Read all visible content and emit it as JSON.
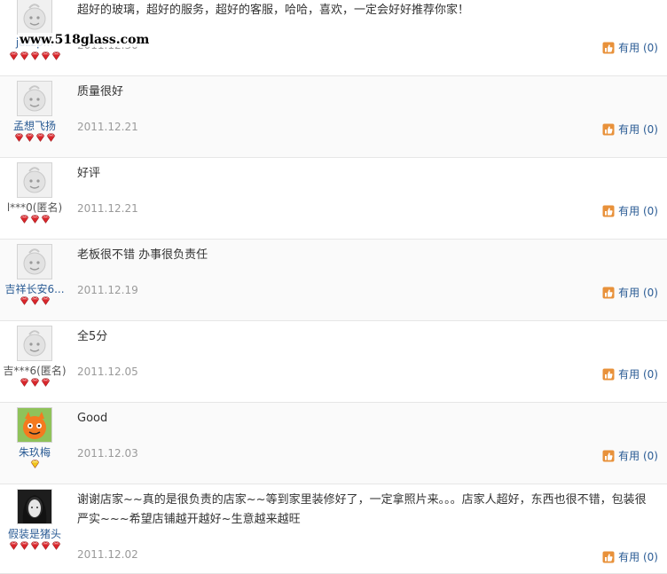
{
  "watermark": "www.518glass.com",
  "useful_label": "有用 (0)",
  "reviews": [
    {
      "user": "jazzp...",
      "comment": "超好的玻璃，超好的服务，超好的客服，哈哈，喜欢，一定会好好推荐你家！",
      "date": "2011.12.30",
      "avatar": "default-avatar",
      "rank": "red-diamond",
      "rank_count": 5
    },
    {
      "user": "孟想飞扬",
      "comment": "质量很好",
      "date": "2011.12.21",
      "avatar": "default-avatar",
      "rank": "red-diamond",
      "rank_count": 4
    },
    {
      "user": "l***0(匿名)",
      "comment": "好评",
      "date": "2011.12.21",
      "avatar": "default-avatar",
      "rank": "red-diamond",
      "rank_count": 3
    },
    {
      "user": "吉祥长安6...",
      "comment": "老板很不错 办事很负责任",
      "date": "2011.12.19",
      "avatar": "default-avatar",
      "rank": "red-diamond",
      "rank_count": 3
    },
    {
      "user": "吉***6(匿名)",
      "comment": "全5分",
      "date": "2011.12.05",
      "avatar": "default-avatar",
      "rank": "red-diamond",
      "rank_count": 3
    },
    {
      "user": "朱玖梅",
      "comment": "Good",
      "date": "2011.12.03",
      "avatar": "orange-cartoon-avatar",
      "rank": "yellow-diamond",
      "rank_count": 1
    },
    {
      "user": "假装是猪头",
      "comment": "谢谢店家~~真的是很负责的店家~~等到家里装修好了，一定拿照片来。。。店家人超好，东西也很不错，包装很严实~~~希望店铺越开越好~生意越来越旺",
      "date": "2011.12.02",
      "avatar": "photo-avatar",
      "rank": "red-diamond",
      "rank_count": 5
    }
  ],
  "colors": {
    "link": "#2a5b94",
    "date": "#9a9a9a",
    "thumb": "#e8913a",
    "gem_red": "#d9262b",
    "gem_yellow": "#f0c419"
  }
}
